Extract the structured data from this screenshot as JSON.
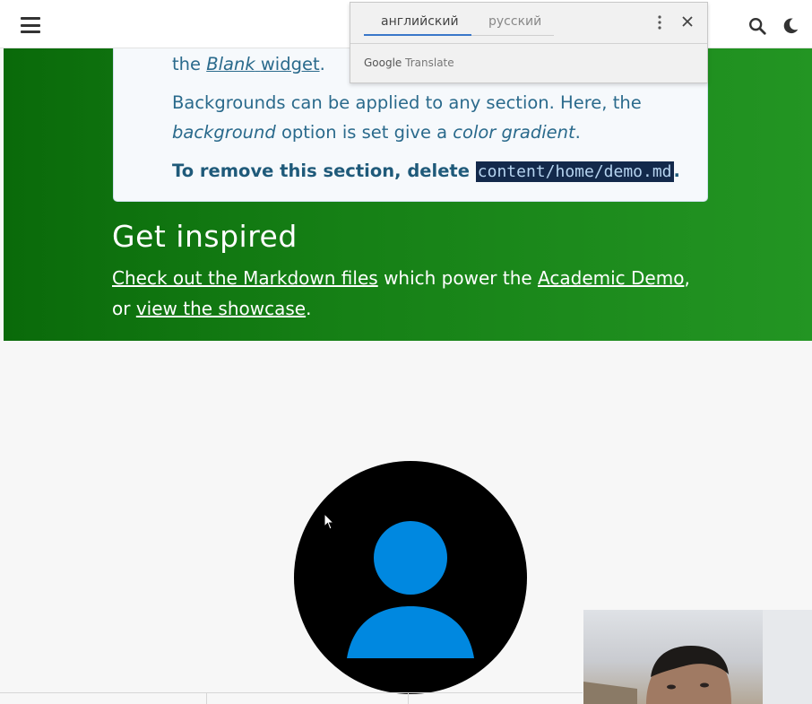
{
  "navbar": {
    "menu_icon": "hamburger-icon",
    "search_icon": "search-icon",
    "theme_icon": "moon-icon"
  },
  "card": {
    "line1_prefix": "the",
    "line1_italic_link": "Blank",
    "line1_link": "widget",
    "line1_suffix": ".",
    "line2": "Backgrounds can be applied to any section. Here, the",
    "line3_italic1": "background",
    "line3_mid": "option is set give a",
    "line3_italic2": "color gradient",
    "line3_end": ".",
    "line4_text": "To remove this section, delete",
    "line4_code": "content/home/demo.md",
    "line4_end": "."
  },
  "inspire": {
    "heading": "Get inspired",
    "link1": "Check out the Markdown files",
    "text1": "which power the",
    "link2": "Academic Demo",
    "text2": ", or",
    "link3": "view the showcase",
    "text3": "."
  },
  "translate_popup": {
    "tab_source": "английский",
    "tab_target": "русский",
    "brand": "Google",
    "product": "Translate",
    "more_icon": "more-vert-icon",
    "close_icon": "close-icon"
  },
  "colors": {
    "gradient_start": "#0a6a0a",
    "gradient_end": "#239523",
    "card_text": "#2a6a8c",
    "avatar_bg": "#000000",
    "avatar_person": "#0088e0",
    "tab_active": "#3a77c9"
  },
  "avatar": {
    "icon": "user-avatar-icon"
  }
}
